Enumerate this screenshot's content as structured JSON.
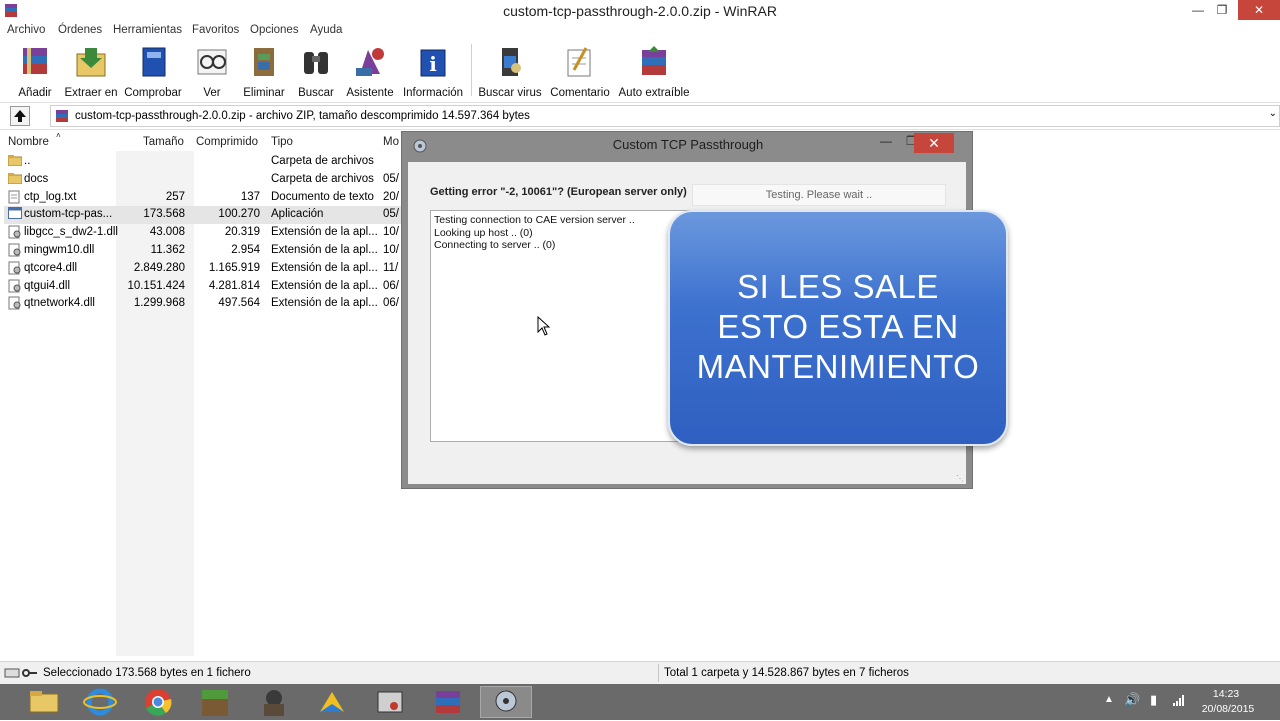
{
  "window": {
    "title": "custom-tcp-passthrough-2.0.0.zip - WinRAR"
  },
  "menu": [
    "Archivo",
    "Órdenes",
    "Herramientas",
    "Favoritos",
    "Opciones",
    "Ayuda"
  ],
  "toolbar": [
    {
      "label": "Añadir",
      "icon": "add-archive-icon"
    },
    {
      "label": "Extraer en",
      "icon": "extract-icon"
    },
    {
      "label": "Comprobar",
      "icon": "test-icon"
    },
    {
      "label": "Ver",
      "icon": "view-icon"
    },
    {
      "label": "Eliminar",
      "icon": "delete-icon"
    },
    {
      "label": "Buscar",
      "icon": "find-icon"
    },
    {
      "label": "Asistente",
      "icon": "wizard-icon"
    },
    {
      "label": "Información",
      "icon": "info-icon"
    },
    {
      "label": "Buscar virus",
      "icon": "virus-scan-icon"
    },
    {
      "label": "Comentario",
      "icon": "comment-icon"
    },
    {
      "label": "Auto extraíble",
      "icon": "sfx-icon"
    }
  ],
  "path": {
    "text": "custom-tcp-passthrough-2.0.0.zip - archivo ZIP, tamaño descomprimido 14.597.364 bytes"
  },
  "columns": {
    "name": "Nombre",
    "size": "Tamaño",
    "packed": "Comprimido",
    "type": "Tipo",
    "modified": "Mo"
  },
  "files": [
    {
      "name": "..",
      "size": "",
      "packed": "",
      "type": "Carpeta de archivos",
      "modified": "",
      "kind": "folder"
    },
    {
      "name": "docs",
      "size": "",
      "packed": "",
      "type": "Carpeta de archivos",
      "modified": "05/",
      "kind": "folder"
    },
    {
      "name": "ctp_log.txt",
      "size": "257",
      "packed": "137",
      "type": "Documento de texto",
      "modified": "20/",
      "kind": "txt"
    },
    {
      "name": "custom-tcp-pas...",
      "size": "173.568",
      "packed": "100.270",
      "type": "Aplicación",
      "modified": "05/",
      "kind": "exe"
    },
    {
      "name": "libgcc_s_dw2-1.dll",
      "size": "43.008",
      "packed": "20.319",
      "type": "Extensión de la apl...",
      "modified": "10/",
      "kind": "dll"
    },
    {
      "name": "mingwm10.dll",
      "size": "11.362",
      "packed": "2.954",
      "type": "Extensión de la apl...",
      "modified": "10/",
      "kind": "dll"
    },
    {
      "name": "qtcore4.dll",
      "size": "2.849.280",
      "packed": "1.165.919",
      "type": "Extensión de la apl...",
      "modified": "11/",
      "kind": "dll"
    },
    {
      "name": "qtgui4.dll",
      "size": "10.151.424",
      "packed": "4.281.814",
      "type": "Extensión de la apl...",
      "modified": "06/",
      "kind": "dll"
    },
    {
      "name": "qtnetwork4.dll",
      "size": "1.299.968",
      "packed": "497.564",
      "type": "Extensión de la apl...",
      "modified": "06/",
      "kind": "dll"
    }
  ],
  "selected_row": 3,
  "status": {
    "left": "Seleccionado 173.568 bytes en 1 fichero",
    "right": "Total 1 carpeta y 14.528.867 bytes en 7 ficheros"
  },
  "dialog": {
    "title": "Custom TCP Passthrough",
    "error_label": "Getting error \"-2, 10061\"? (European server only)",
    "button": "Testing. Please wait ..",
    "log": [
      "Testing connection to CAE version server ..",
      "Looking up host .. (0)",
      "Connecting to server .. (0)"
    ]
  },
  "banner": {
    "lines": [
      "SI LES SALE",
      "ESTO ESTA EN",
      "MANTENIMIENTO"
    ]
  },
  "clock": {
    "time": "14:23",
    "date": "20/08/2015"
  },
  "taskbar": [
    "file-explorer-icon",
    "internet-explorer-icon",
    "chrome-icon",
    "minecraft-icon",
    "game-character-icon",
    "sketchup-icon",
    "app-icon",
    "winrar-icon",
    "network-app-icon"
  ],
  "colors": {
    "banner_top": "#6b98dd",
    "banner_bottom": "#2f5fc0",
    "close_red": "#c7463c",
    "taskbar": "#6a6a6a"
  }
}
